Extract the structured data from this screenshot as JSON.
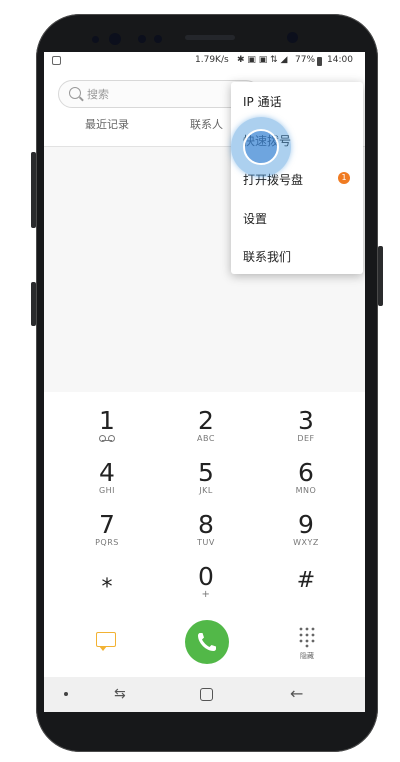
{
  "statusbar": {
    "speed": "1.79K/s",
    "battery": "77%",
    "time": "14:00"
  },
  "search": {
    "placeholder": "搜索"
  },
  "tabs": [
    {
      "label": "最近记录"
    },
    {
      "label": "联系人"
    }
  ],
  "menu": {
    "items": [
      {
        "label": "IP 通话"
      },
      {
        "label": "快速拨号"
      },
      {
        "label": "打开拨号盘"
      },
      {
        "label": "设置"
      },
      {
        "label": "联系我们"
      }
    ],
    "badge": "1"
  },
  "keypad": [
    {
      "digit": "1",
      "letters": ""
    },
    {
      "digit": "2",
      "letters": "ABC"
    },
    {
      "digit": "3",
      "letters": "DEF"
    },
    {
      "digit": "4",
      "letters": "GHI"
    },
    {
      "digit": "5",
      "letters": "JKL"
    },
    {
      "digit": "6",
      "letters": "MNO"
    },
    {
      "digit": "7",
      "letters": "PQRS"
    },
    {
      "digit": "8",
      "letters": "TUV"
    },
    {
      "digit": "9",
      "letters": "WXYZ"
    },
    {
      "digit": "⁎",
      "letters": ""
    },
    {
      "digit": "0",
      "letters": "+"
    },
    {
      "digit": "#",
      "letters": ""
    }
  ],
  "actions": {
    "hide_label": "隐藏"
  },
  "colors": {
    "call": "#52b848",
    "badge": "#f07b22",
    "message": "#f2b233"
  },
  "icons": [
    "search-icon",
    "voicemail-icon",
    "message-icon",
    "phone-icon",
    "keypad-icon",
    "recent-apps-icon",
    "home-icon",
    "back-icon"
  ]
}
